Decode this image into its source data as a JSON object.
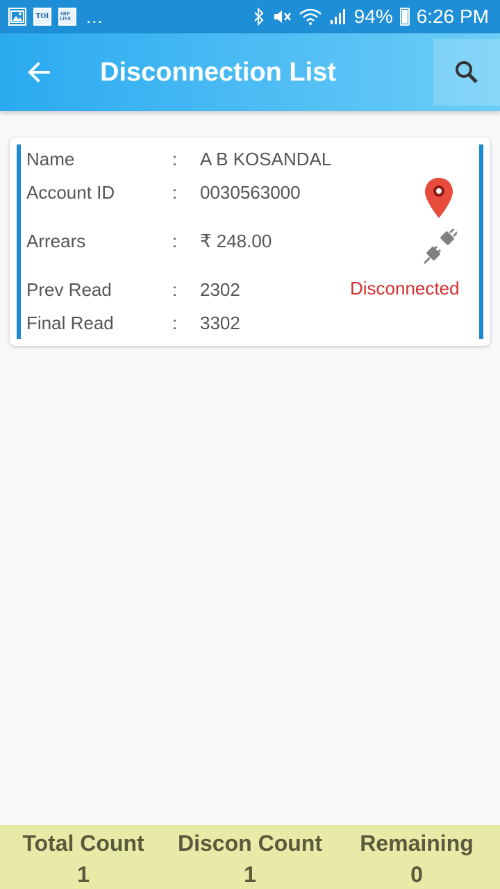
{
  "status_bar": {
    "notif_icons": [
      "image-icon",
      "toi-icon",
      "abp-live-icon"
    ],
    "notif_toi_text": "TOI",
    "notif_abp_text": "ABP LIVE",
    "more": "...",
    "battery": "94%",
    "time": "6:26 PM"
  },
  "app_bar": {
    "title": "Disconnection List"
  },
  "record": {
    "labels": {
      "name": "Name",
      "account_id": "Account ID",
      "arrears": "Arrears",
      "prev_read": "Prev Read",
      "final_read": "Final Read"
    },
    "separator": ":",
    "values": {
      "name": "A B KOSANDAL",
      "account_id": "0030563000",
      "arrears": "₹ 248.00",
      "prev_read": "2302",
      "final_read": "3302"
    },
    "status": "Disconnected",
    "status_color": "#d32f2f",
    "accent_color": "#1e88d0"
  },
  "footer": {
    "total_label": "Total Count",
    "total_value": "1",
    "discon_label": "Discon Count",
    "discon_value": "1",
    "remaining_label": "Remaining",
    "remaining_value": "0",
    "background": "#e8eba8"
  }
}
